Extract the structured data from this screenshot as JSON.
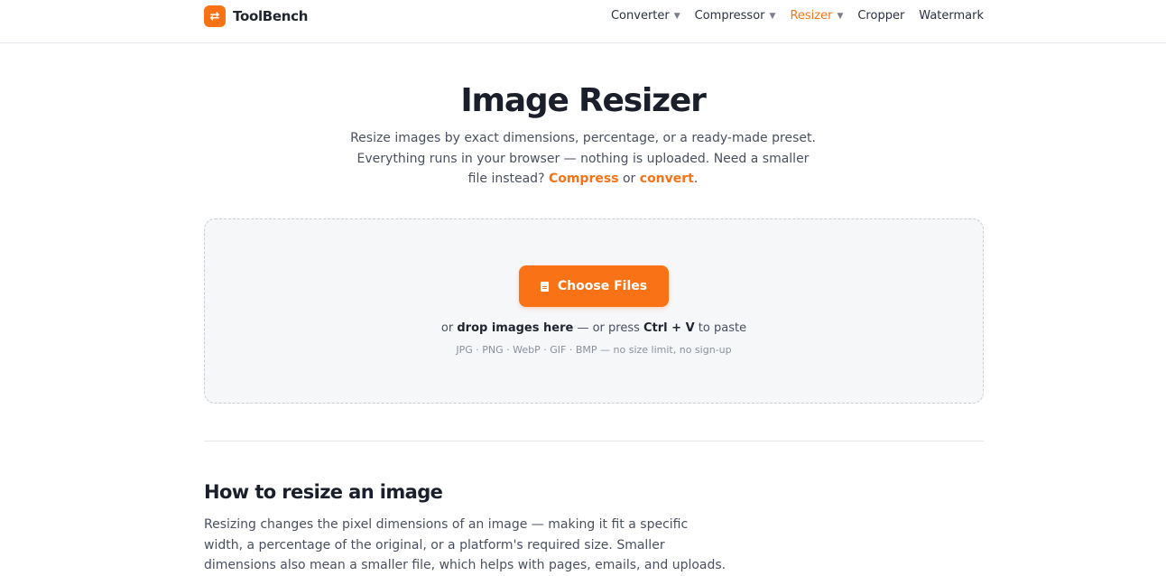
{
  "brand": {
    "icon": "swap-arrows-icon",
    "name": "ToolBench",
    "accent_color": "#f97316"
  },
  "nav": [
    {
      "label": "Converter",
      "has_dropdown": true,
      "active": false
    },
    {
      "label": "Compressor",
      "has_dropdown": true,
      "active": false
    },
    {
      "label": "Resizer",
      "has_dropdown": true,
      "active": true
    },
    {
      "label": "Cropper",
      "has_dropdown": false,
      "active": false
    },
    {
      "label": "Watermark",
      "has_dropdown": false,
      "active": false
    }
  ],
  "hero": {
    "title": "Image Resizer",
    "desc_line1": "Resize images by exact dimensions, percentage, or a ready-made preset.",
    "desc_line2": "Everything runs in your browser — nothing is uploaded. Need a smaller file",
    "desc_line3_prefix": "instead?",
    "compress_link": "Compress",
    "or_text": "or",
    "convert_link": "convert",
    "period": "."
  },
  "dropzone": {
    "button_label": "Choose Files",
    "button_icon": "file-icon",
    "hint_or": "or",
    "hint_drop": "drop images here",
    "hint_mid": "— or press",
    "hint_keys": "Ctrl + V",
    "hint_end": "to paste",
    "formats": "JPG · PNG · WebP · GIF · BMP — no size limit, no sign-up"
  },
  "howto": {
    "title": "How to resize an image",
    "text_line1": "Resizing changes the pixel dimensions of an image — making it fit a specific width, a",
    "text_line2": "percentage of the original, or a platform's required size. Smaller dimensions also mean a",
    "text_line3": "smaller file, which helps with pages, emails, and uploads."
  }
}
